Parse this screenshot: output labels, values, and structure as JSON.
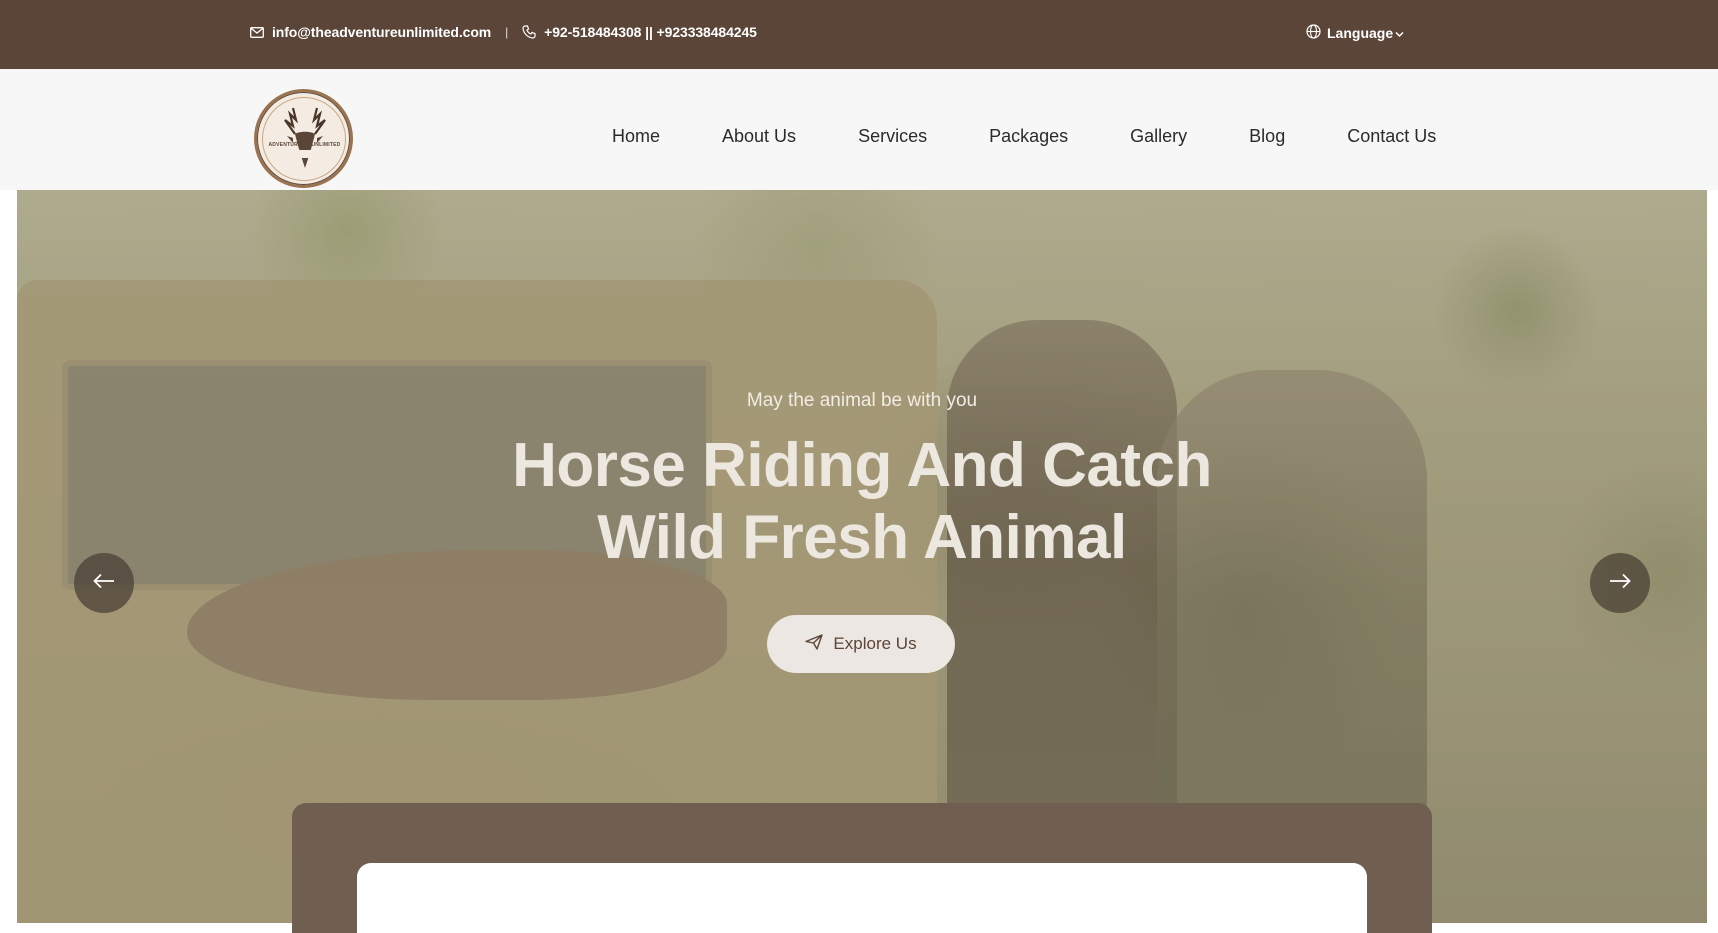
{
  "topbar": {
    "email": "info@theadventureunlimited.com",
    "separator": "|",
    "phone": "+92-518484308 || +923338484245",
    "language_label": "Language"
  },
  "logo": {
    "ribbon_left": "ADVENTURE",
    "ribbon_right": "UNLIMITED"
  },
  "nav": {
    "items": [
      "Home",
      "About Us",
      "Services",
      "Packages",
      "Gallery",
      "Blog",
      "Contact Us"
    ]
  },
  "hero": {
    "subtitle": "May the animal be with you",
    "title_line1": "Horse Riding And Catch",
    "title_line2": "Wild Fresh Animal",
    "button_label": "Explore Us"
  },
  "colors": {
    "brand_brown": "#5b4538",
    "panel_brown": "#705e50"
  }
}
